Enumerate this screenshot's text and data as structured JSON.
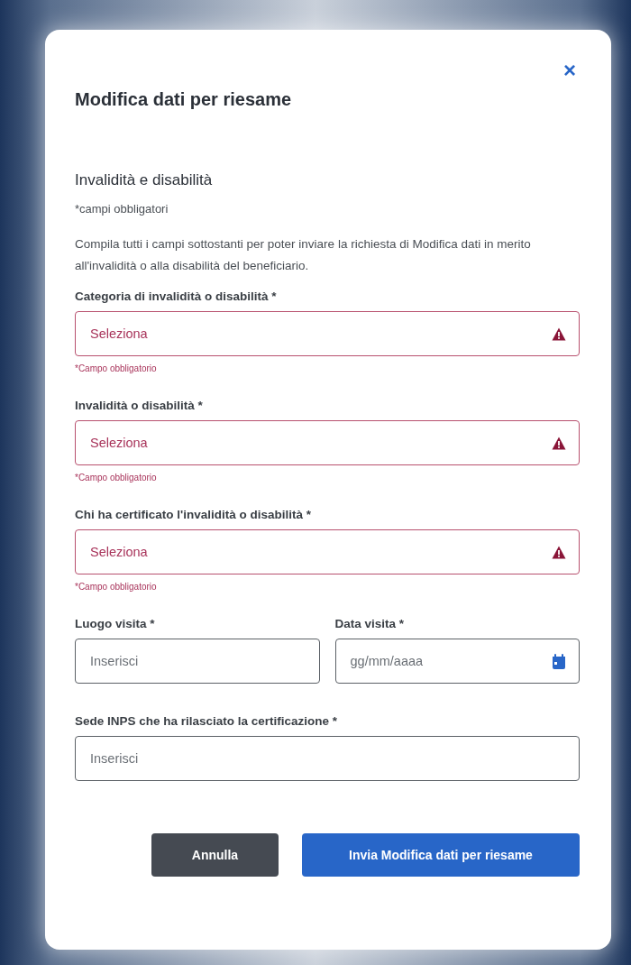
{
  "dialog": {
    "title": "Modifica dati per riesame",
    "close": "×"
  },
  "section": {
    "heading": "Invalidità e disabilità",
    "required_note": "*campi obbligatori",
    "intro": "Compila tutti i campi sottostanti per poter inviare la richiesta di Modifica dati in merito all'invalidità o alla disabilità del beneficiario."
  },
  "rows": [
    [
      {
        "kind": "select",
        "label": "Categoria di invalidità o disabilità *",
        "placeholder": "Seleziona",
        "invalid": true,
        "error": "*Campo obbligatorio"
      }
    ],
    [
      {
        "kind": "select",
        "label": "Invalidità o disabilità *",
        "placeholder": "Seleziona",
        "invalid": true,
        "error": "*Campo obbligatorio"
      }
    ],
    [
      {
        "kind": "select",
        "label": "Chi ha certificato l'invalidità o disabilità *",
        "placeholder": "Seleziona",
        "invalid": true,
        "error": "*Campo obbligatorio"
      }
    ],
    [
      {
        "kind": "text",
        "label": "Luogo visita *",
        "placeholder": "Inserisci",
        "invalid": false
      },
      {
        "kind": "date",
        "label": "Data visita *",
        "placeholder": "gg/mm/aaaa",
        "invalid": false
      }
    ],
    [
      {
        "kind": "text",
        "label": "Sede INPS che ha rilasciato la certificazione *",
        "placeholder": "Inserisci",
        "invalid": false
      }
    ]
  ],
  "buttons": [
    {
      "kind": "secondary",
      "label": "Annulla"
    },
    {
      "kind": "primary",
      "label": "Invia Modifica dati per riesame"
    }
  ]
}
